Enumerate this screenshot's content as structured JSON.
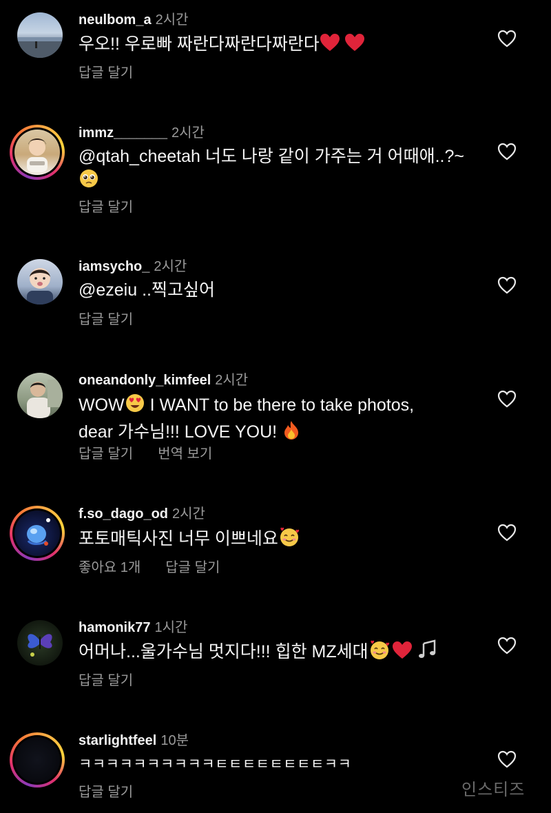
{
  "comments": [
    {
      "username": "neulbom_a",
      "time": "2시간",
      "text": "우오!! 우로빠 짜란다짜란다짜란다",
      "emojis": [
        "red-heart",
        "red-heart"
      ],
      "reply_label": "답글 달기"
    },
    {
      "username": "immz_______",
      "time": "2시간",
      "text": "@qtah_cheetah 너도 나랑 같이 가주는 거 어때애..?~",
      "emojis": [
        "pleading-face"
      ],
      "reply_label": "답글 달기"
    },
    {
      "username": "iamsycho_",
      "time": "2시간",
      "text": "@ezeiu ..찍고싶어",
      "reply_label": "답글 달기"
    },
    {
      "username": "oneandonly_kimfeel",
      "time": "2시간",
      "text_a": "WOW",
      "text_b": " I WANT to be there to take photos,",
      "text_c": "dear 가수님!!! LOVE YOU! ",
      "emojis": [
        "heart-eyes",
        "fire"
      ],
      "reply_label": "답글 달기",
      "translate_label": "번역 보기"
    },
    {
      "username": "f.so_dago_od",
      "time": "2시간",
      "text": "포토매틱사진 너무 이쁘네요",
      "emojis": [
        "smiling-face-with-hearts"
      ],
      "likes_label": "좋아요 1개",
      "reply_label": "답글 달기"
    },
    {
      "username": "hamonik77",
      "time": "1시간",
      "text_a": "어머나...울가수님 멋지다!!! 힙한 MZ세대",
      "emojis": [
        "smiling-face-with-hearts",
        "red-heart",
        "musical-notes"
      ],
      "reply_label": "답글 달기"
    },
    {
      "username": "starlightfeel",
      "time": "10분",
      "text": "ㅋㅋㅋㅋㅋㅋㅋㅋㅋㅋㅌㅌㅌㅌㅌㅌㅌㅌㅋㅋ",
      "reply_label": "답글 달기"
    }
  ],
  "watermark": "인스티즈",
  "colors": {
    "background": "#000000",
    "text": "#f5f5f5",
    "secondary": "#9a9a9a",
    "heart": "#e0243a"
  }
}
